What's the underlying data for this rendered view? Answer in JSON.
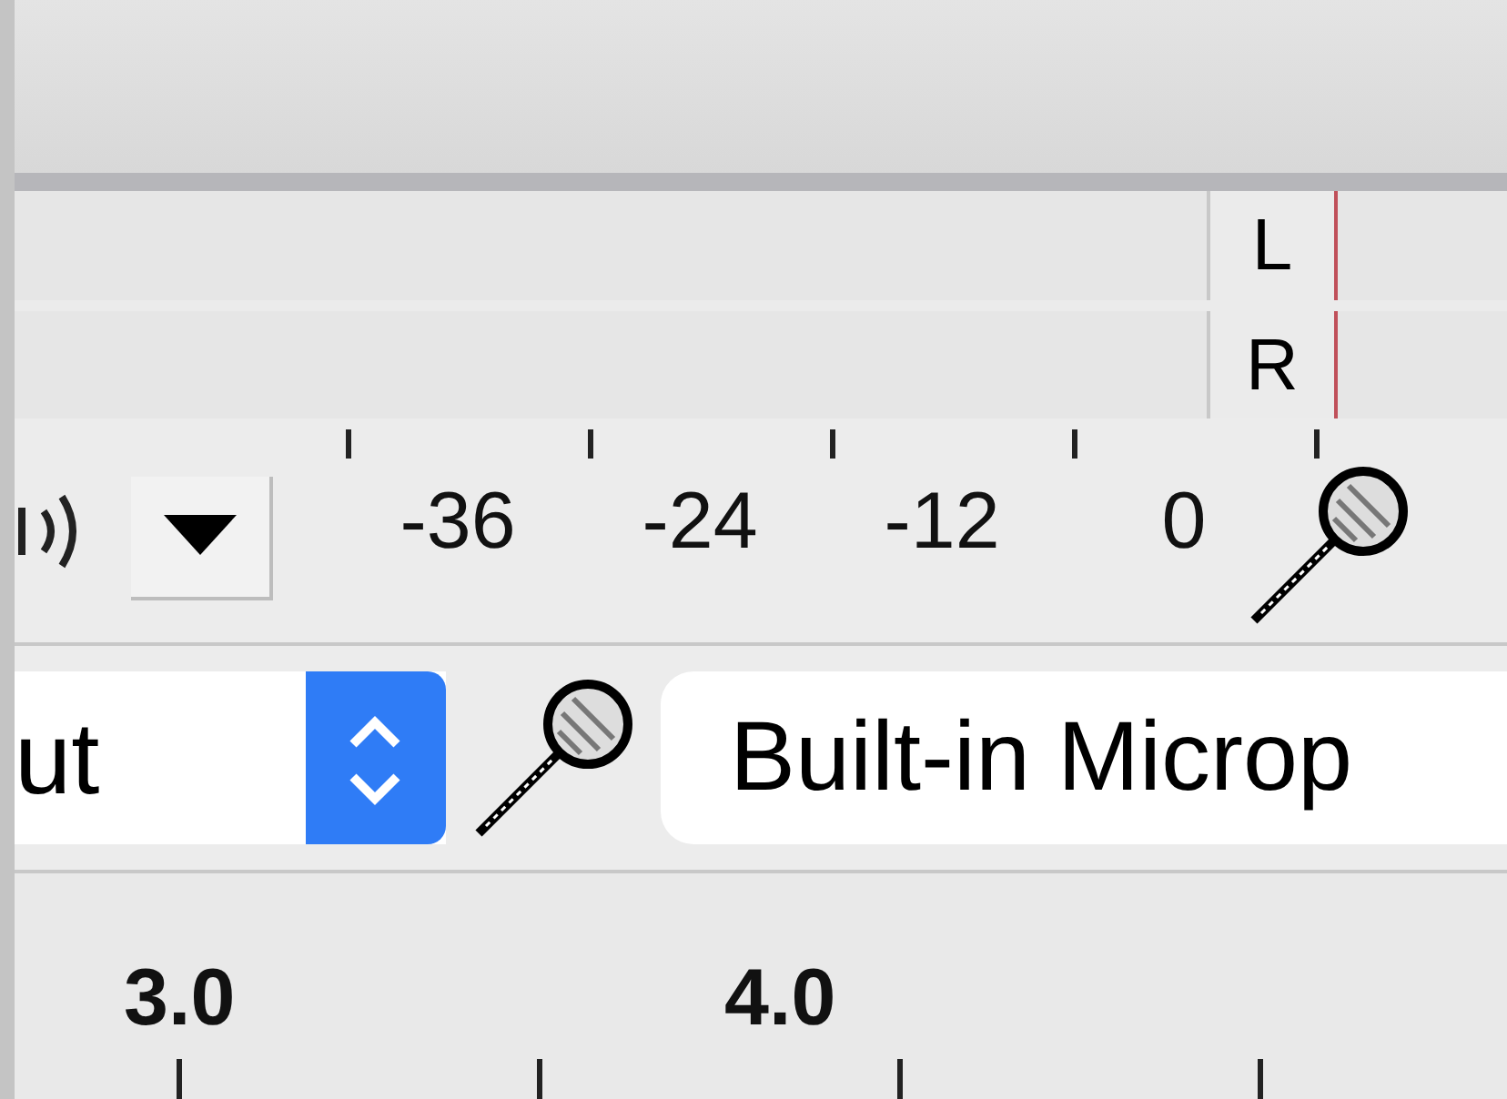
{
  "meter": {
    "channels": [
      {
        "label": "L"
      },
      {
        "label": "R"
      }
    ]
  },
  "scale": {
    "labels": [
      "-36",
      "-24",
      "-12",
      "0"
    ]
  },
  "input_channels": {
    "value": "ut"
  },
  "input_device": {
    "value": "Built-in Microp"
  },
  "timeline": {
    "labels": [
      "3.0",
      "4.0"
    ]
  }
}
